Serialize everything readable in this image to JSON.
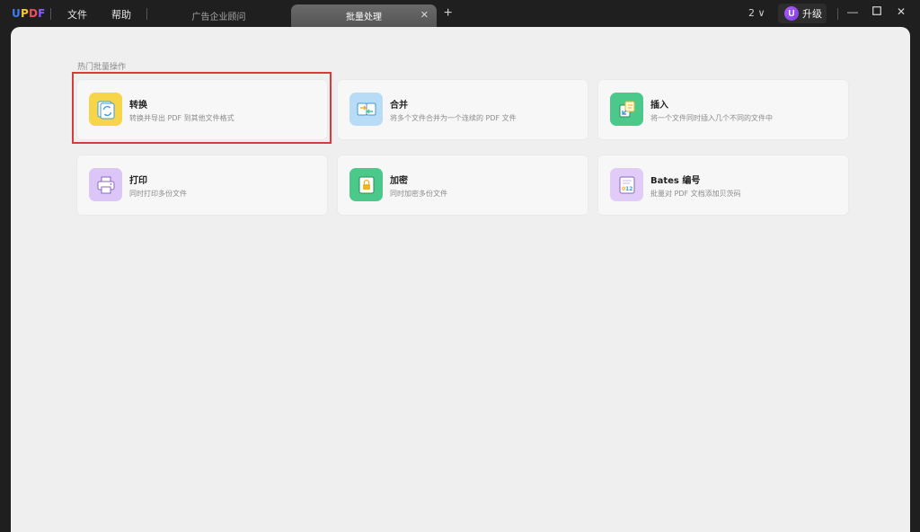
{
  "app": {
    "logo_letters": [
      {
        "ch": "U",
        "color": "#3d7bf7"
      },
      {
        "ch": "P",
        "color": "#f5c731"
      },
      {
        "ch": "D",
        "color": "#ef4f5a"
      },
      {
        "ch": "F",
        "color": "#8a5cf6"
      }
    ],
    "menu": {
      "file": "文件",
      "help": "帮助"
    },
    "tabs": [
      {
        "label": "广告企业顾问",
        "active": false
      },
      {
        "label": "批量处理",
        "active": true
      }
    ],
    "new_tab_glyph": "+",
    "tab_close_glyph": "✕",
    "window_count": "2 ∨",
    "upgrade": {
      "avatar_letter": "U",
      "label": "升级"
    },
    "window_controls": {
      "minimize": "—",
      "maximize": "☐",
      "close": "✕"
    }
  },
  "batch": {
    "section_title": "热门批量操作",
    "cards": [
      {
        "title": "转换",
        "desc": "转换并导出 PDF 到其他文件格式",
        "icon": "convert-icon",
        "icon_bg": "#f7d548"
      },
      {
        "title": "合并",
        "desc": "将多个文件合并为一个连续的 PDF 文件",
        "icon": "merge-icon",
        "icon_bg": "#b8dcf6"
      },
      {
        "title": "插入",
        "desc": "将一个文件同时插入几个不同的文件中",
        "icon": "insert-icon",
        "icon_bg": "#4bc98a"
      },
      {
        "title": "打印",
        "desc": "同时打印多份文件",
        "icon": "print-icon",
        "icon_bg": "#dcc6f7"
      },
      {
        "title": "加密",
        "desc": "同时加密多份文件",
        "icon": "encrypt-icon",
        "icon_bg": "#4bc98a"
      },
      {
        "title": "Bates 编号",
        "desc": "批量对 PDF 文档添加贝茨码",
        "icon": "bates-number-icon",
        "icon_bg": "#e0ccf7"
      }
    ]
  },
  "highlight_color": "#d93a3a"
}
